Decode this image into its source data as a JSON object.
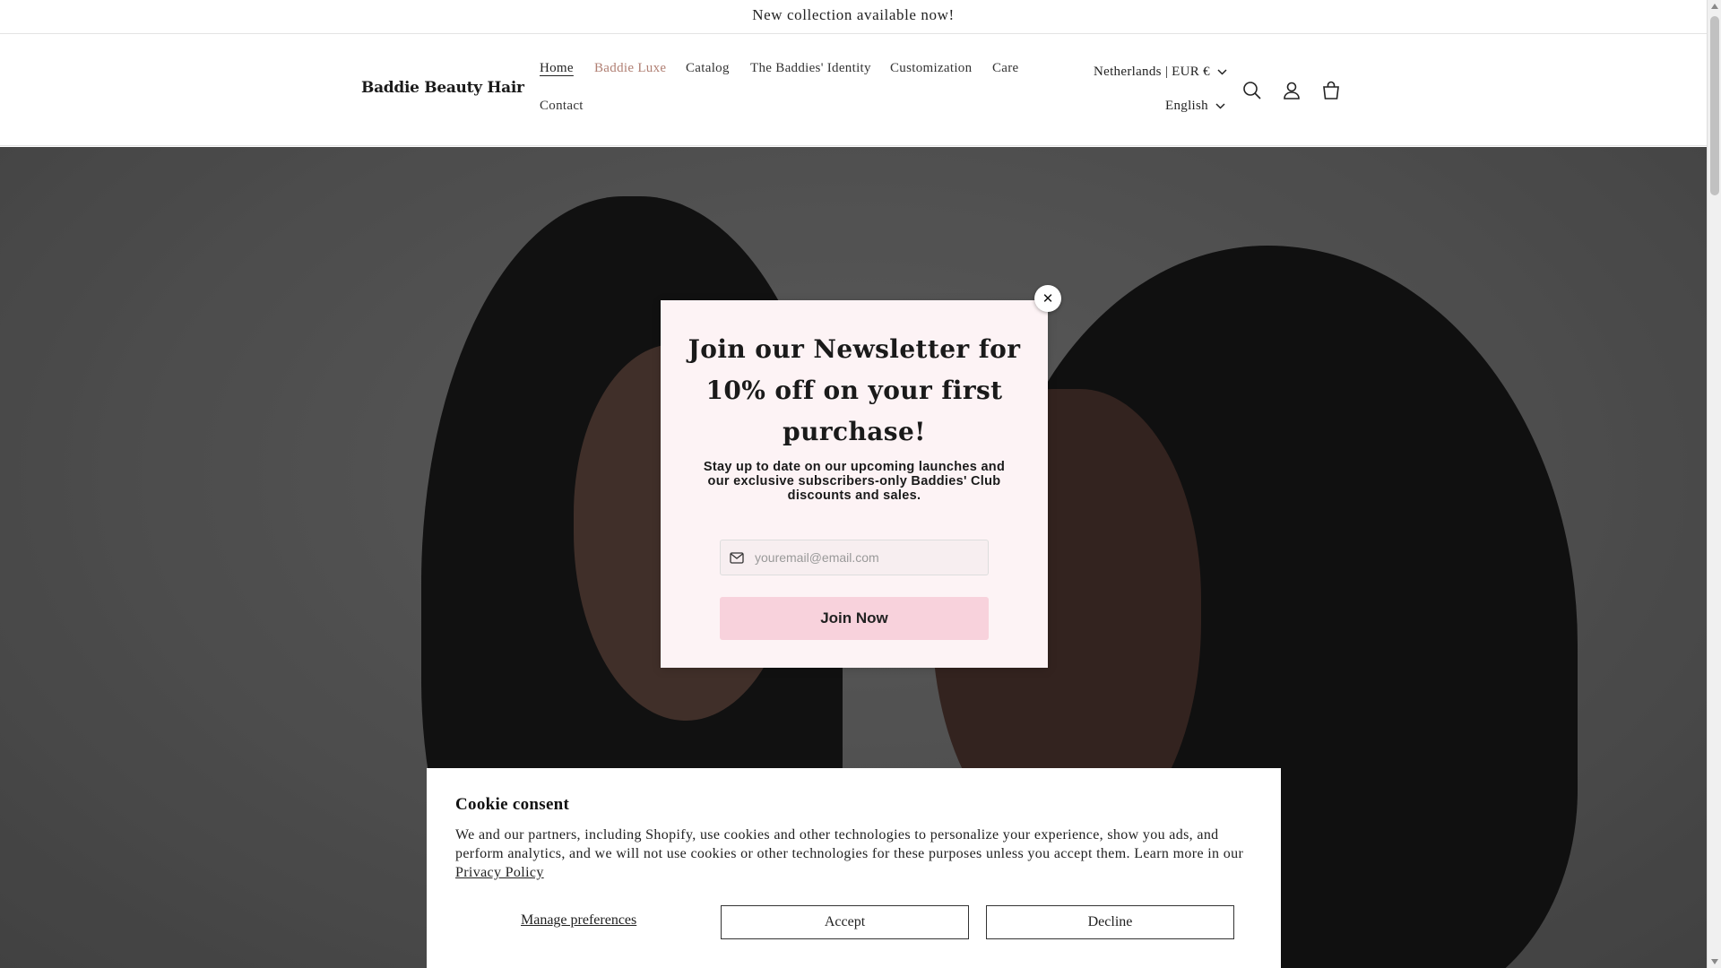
{
  "announcement": "New collection available now!",
  "header": {
    "logo": "Baddie Beauty Hair",
    "nav": [
      {
        "label": "Home"
      },
      {
        "label": "Baddie Luxe"
      },
      {
        "label": "Catalog"
      },
      {
        "label": "The Baddies' Identity"
      },
      {
        "label": "Customization"
      },
      {
        "label": "Care"
      },
      {
        "label": "Contact"
      }
    ],
    "country": "Netherlands | EUR €",
    "language": "English",
    "icons": [
      "search-icon",
      "account-icon",
      "cart-icon"
    ]
  },
  "newsletter": {
    "title": "Join our Newsletter for 10% off on your first purchase!",
    "text": "Stay up to date on our upcoming launches and our exclusive subscribers-only Baddies' Club discounts and sales.",
    "email_placeholder": "youremail@email.com",
    "button": "Join Now"
  },
  "cookie": {
    "title": "Cookie consent",
    "text": "We and our partners, including Shopify, use cookies and other technologies to personalize your experience, show you ads, and perform analytics, and we will not use cookies or other technologies for these purposes unless you accept them. Learn more in our",
    "privacy_link": "Privacy Policy",
    "manage": "Manage preferences",
    "accept": "Accept",
    "decline": "Decline"
  },
  "colors": {
    "popup_bg": "#fdf3f5",
    "join_button": "#f8d2dc",
    "luxe_link": "#b07f73"
  }
}
